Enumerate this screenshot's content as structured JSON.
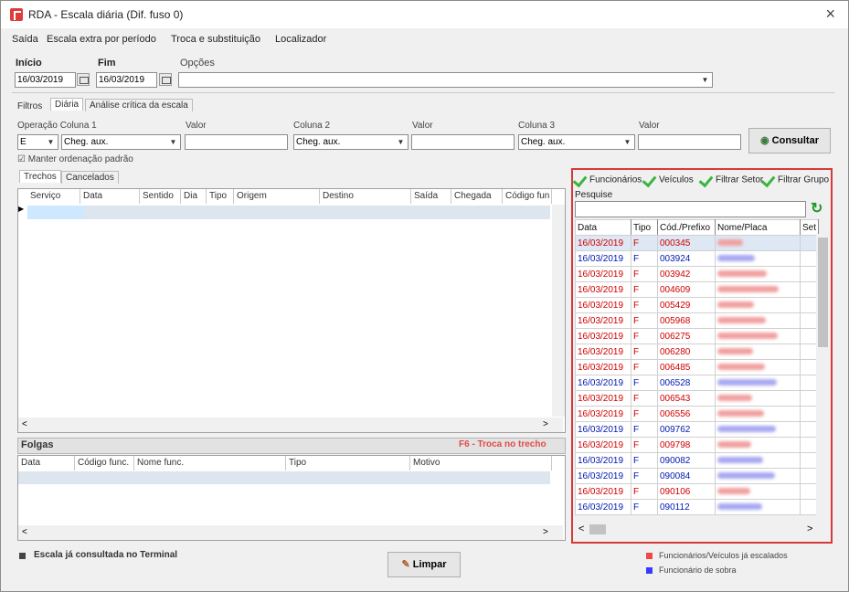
{
  "window": {
    "title": "RDA - Escala diária (Dif. fuso 0)",
    "close": "×"
  },
  "menu": [
    "Saída",
    "Escala extra por período",
    "Troca e substituição",
    "Localizador"
  ],
  "filters": {
    "inicio_label": "Início",
    "fim_label": "Fim",
    "opcoes_label": "Opções",
    "inicio_value": "16/03/2019",
    "fim_value": "16/03/2019"
  },
  "tabs": [
    "Filtros",
    "Diária",
    "Análise crítica da escala"
  ],
  "operacao": {
    "col1_label": "Operação Coluna 1",
    "valor1_label": "Valor",
    "col2_label": "Coluna 2",
    "valor2_label": "Valor",
    "col3_label": "Coluna 3",
    "valor3_label": "Valor",
    "op_value": "E",
    "col1_value": "Cheg. aux.",
    "col2_value": "Cheg. aux.",
    "col3_value": "Cheg. aux.",
    "manter": "Manter ordenação padrão",
    "consultar": "Consultar"
  },
  "subtabs": [
    "Trechos",
    "Cancelados"
  ],
  "trechos_cols": [
    "Serviço",
    "Data",
    "Sentido",
    "Dia",
    "Tipo",
    "Origem",
    "Destino",
    "Saída",
    "Chegada",
    "Código fun"
  ],
  "folgas": {
    "title": "Folgas",
    "note": "F6 - Troca no trecho",
    "cols": [
      "Data",
      "Código func.",
      "Nome func.",
      "Tipo",
      "Motivo"
    ]
  },
  "right_panel": {
    "checks": [
      "Funcionários",
      "Veículos",
      "Filtrar Setor",
      "Filtrar Grupo"
    ],
    "pesquise": "Pesquise",
    "cols": [
      "Data",
      "Tipo",
      "Cód./Prefixo",
      "Nome/Placa",
      "Set"
    ],
    "rows": [
      {
        "data": "16/03/2019",
        "tipo": "F",
        "cod": "000345",
        "color": "#d00000"
      },
      {
        "data": "16/03/2019",
        "tipo": "F",
        "cod": "003924",
        "color": "#0018b0"
      },
      {
        "data": "16/03/2019",
        "tipo": "F",
        "cod": "003942",
        "color": "#d00000"
      },
      {
        "data": "16/03/2019",
        "tipo": "F",
        "cod": "004609",
        "color": "#d00000"
      },
      {
        "data": "16/03/2019",
        "tipo": "F",
        "cod": "005429",
        "color": "#d00000"
      },
      {
        "data": "16/03/2019",
        "tipo": "F",
        "cod": "005968",
        "color": "#d00000"
      },
      {
        "data": "16/03/2019",
        "tipo": "F",
        "cod": "006275",
        "color": "#d00000"
      },
      {
        "data": "16/03/2019",
        "tipo": "F",
        "cod": "006280",
        "color": "#d00000"
      },
      {
        "data": "16/03/2019",
        "tipo": "F",
        "cod": "006485",
        "color": "#d00000"
      },
      {
        "data": "16/03/2019",
        "tipo": "F",
        "cod": "006528",
        "color": "#0018b0"
      },
      {
        "data": "16/03/2019",
        "tipo": "F",
        "cod": "006543",
        "color": "#d00000"
      },
      {
        "data": "16/03/2019",
        "tipo": "F",
        "cod": "006556",
        "color": "#d00000"
      },
      {
        "data": "16/03/2019",
        "tipo": "F",
        "cod": "009762",
        "color": "#0018b0"
      },
      {
        "data": "16/03/2019",
        "tipo": "F",
        "cod": "009798",
        "color": "#d00000"
      },
      {
        "data": "16/03/2019",
        "tipo": "F",
        "cod": "090082",
        "color": "#0018b0"
      },
      {
        "data": "16/03/2019",
        "tipo": "F",
        "cod": "090084",
        "color": "#0018b0"
      },
      {
        "data": "16/03/2019",
        "tipo": "F",
        "cod": "090106",
        "color": "#d00000"
      },
      {
        "data": "16/03/2019",
        "tipo": "F",
        "cod": "090112",
        "color": "#0018b0"
      }
    ]
  },
  "footer": {
    "legend_terminal": "Escala já consultada no Terminal",
    "limpar": "Limpar",
    "legend_red": "Funcionários/Veículos já escalados",
    "legend_blue": "Funcionário de sobra"
  },
  "colors": {
    "red": "#d00000",
    "blue": "#0018b0",
    "panel_border": "#d53a3a",
    "check_green": "#39b53f"
  }
}
